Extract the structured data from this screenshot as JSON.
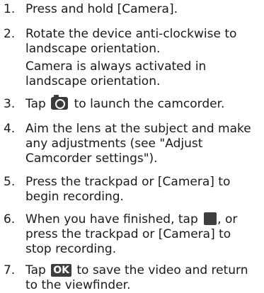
{
  "steps": [
    {
      "number": "1.",
      "lines": [
        "Press and hold [Camera]."
      ]
    },
    {
      "number": "2.",
      "lines": [
        "Rotate the device anti-clockwise to",
        "landscape orientation."
      ],
      "note": [
        "Camera is always activated in",
        "landscape orientation."
      ]
    },
    {
      "number": "3.",
      "before": "Tap",
      "icon": "camera-icon",
      "after": "to launch the camcorder."
    },
    {
      "number": "4.",
      "lines": [
        "Aim the lens at the subject and make",
        "any adjustments (see \"Adjust",
        "Camcorder settings\")."
      ]
    },
    {
      "number": "5.",
      "lines": [
        "Press the trackpad or [Camera] to",
        "begin recording."
      ]
    },
    {
      "number": "6.",
      "before": "When you have finished, tap",
      "icon": "stop-icon",
      "after": ", or",
      "lines": [
        "press the trackpad or [Camera] to",
        "stop recording."
      ]
    },
    {
      "number": "7.",
      "before": "Tap",
      "icon": "ok-icon",
      "icon_label": "OK",
      "after": "to save the video and return",
      "lines": [
        "to the viewfinder."
      ]
    }
  ]
}
